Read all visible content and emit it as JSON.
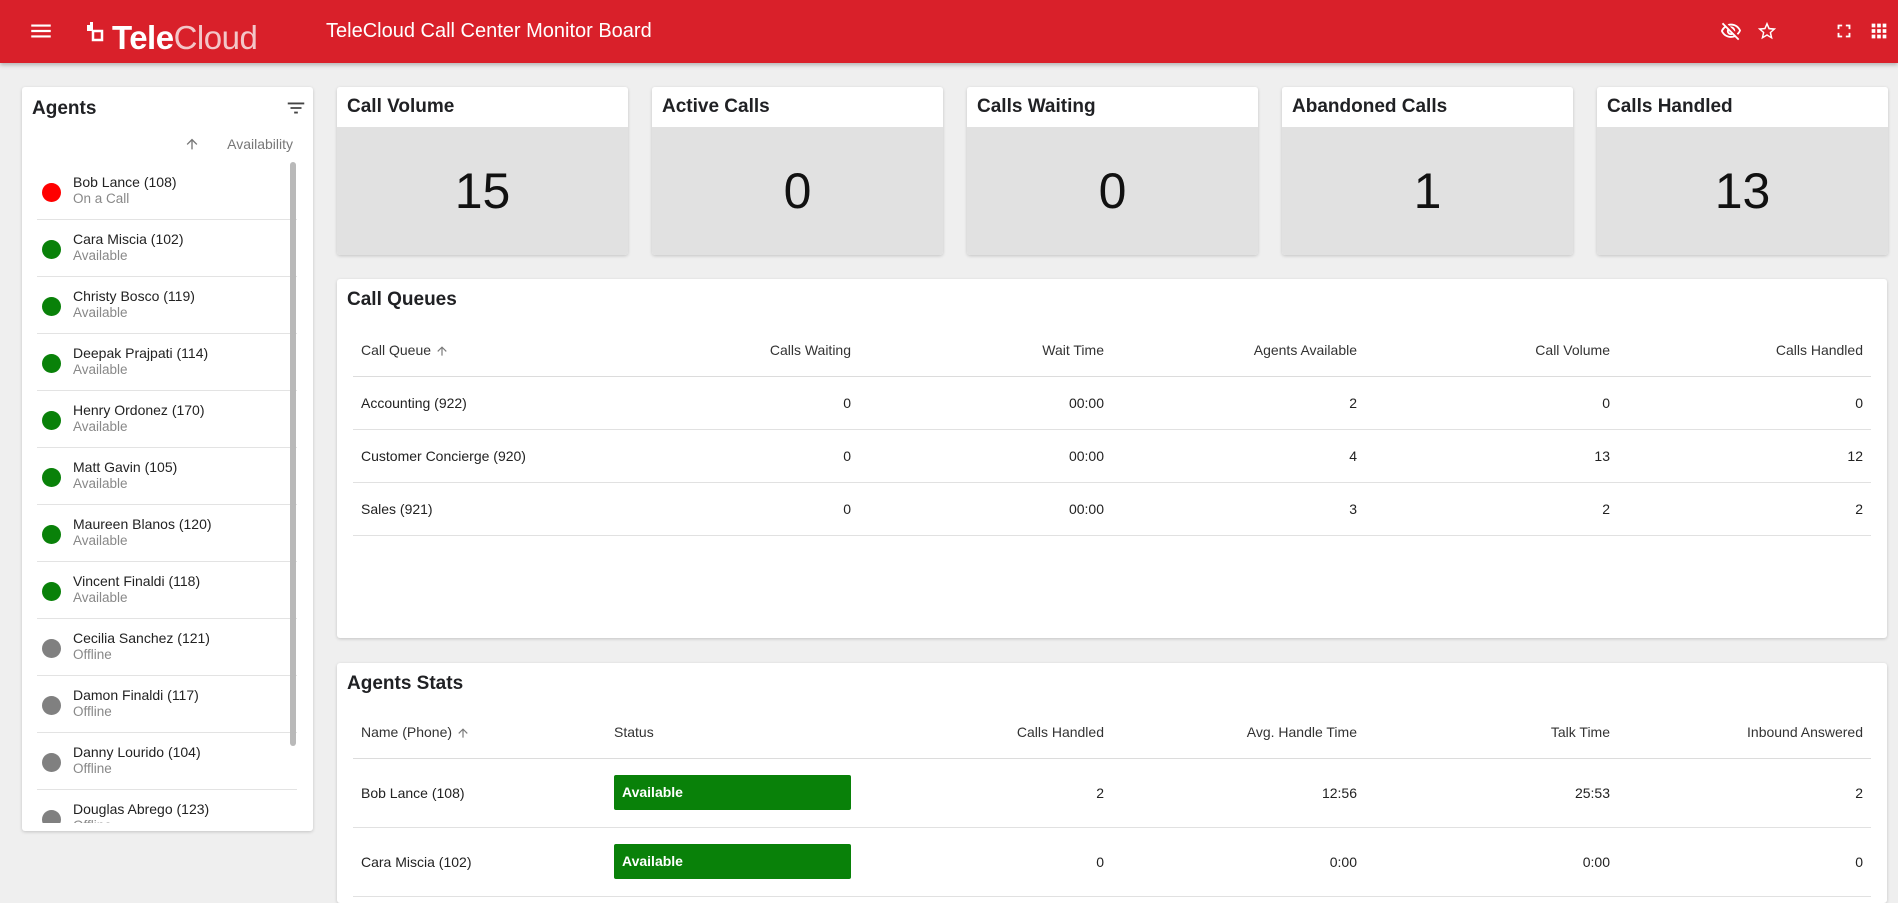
{
  "header": {
    "logo_tele": "Tele",
    "logo_cloud": "Cloud",
    "title": "TeleCloud Call Center Monitor Board",
    "icons": [
      "menu-icon",
      "visibility-off-icon",
      "star-icon",
      "fullscreen-icon",
      "apps-grid-icon"
    ],
    "bar_color": "#d9202a"
  },
  "agents": {
    "title": "Agents",
    "availability_header": "Availability",
    "items": [
      {
        "name": "Bob Lance (108)",
        "status": "On a Call",
        "color": "#ff0000"
      },
      {
        "name": "Cara Miscia (102)",
        "status": "Available",
        "color": "#098109"
      },
      {
        "name": "Christy Bosco (119)",
        "status": "Available",
        "color": "#098109"
      },
      {
        "name": "Deepak Prajpati (114)",
        "status": "Available",
        "color": "#098109"
      },
      {
        "name": "Henry Ordonez (170)",
        "status": "Available",
        "color": "#098109"
      },
      {
        "name": "Matt Gavin (105)",
        "status": "Available",
        "color": "#098109"
      },
      {
        "name": "Maureen Blanos (120)",
        "status": "Available",
        "color": "#098109"
      },
      {
        "name": "Vincent Finaldi (118)",
        "status": "Available",
        "color": "#098109"
      },
      {
        "name": "Cecilia Sanchez (121)",
        "status": "Offline",
        "color": "#808080"
      },
      {
        "name": "Damon Finaldi (117)",
        "status": "Offline",
        "color": "#808080"
      },
      {
        "name": "Danny Lourido (104)",
        "status": "Offline",
        "color": "#808080"
      },
      {
        "name": "Douglas Abrego (123)",
        "status": "Offline",
        "color": "#808080"
      }
    ]
  },
  "tiles": [
    {
      "label": "Call Volume",
      "value": "15"
    },
    {
      "label": "Active Calls",
      "value": "0"
    },
    {
      "label": "Calls Waiting",
      "value": "0"
    },
    {
      "label": "Abandoned Calls",
      "value": "1"
    },
    {
      "label": "Calls Handled",
      "value": "13"
    }
  ],
  "queues": {
    "title": "Call Queues",
    "columns": [
      "Call Queue",
      "Calls Waiting",
      "Wait Time",
      "Agents Available",
      "Call Volume",
      "Calls Handled"
    ],
    "rows": [
      [
        "Accounting (922)",
        "0",
        "00:00",
        "2",
        "0",
        "0"
      ],
      [
        "Customer Concierge (920)",
        "0",
        "00:00",
        "4",
        "13",
        "12"
      ],
      [
        "Sales (921)",
        "0",
        "00:00",
        "3",
        "2",
        "2"
      ]
    ]
  },
  "agent_stats": {
    "title": "Agents Stats",
    "columns": [
      "Name (Phone)",
      "Status",
      "Calls Handled",
      "Avg. Handle Time",
      "Talk Time",
      "Inbound Answered"
    ],
    "rows": [
      [
        "Bob Lance (108)",
        "Available",
        "2",
        "12:56",
        "25:53",
        "2"
      ],
      [
        "Cara Miscia (102)",
        "Available",
        "0",
        "0:00",
        "0:00",
        "0"
      ]
    ],
    "status_color": "#098109"
  }
}
